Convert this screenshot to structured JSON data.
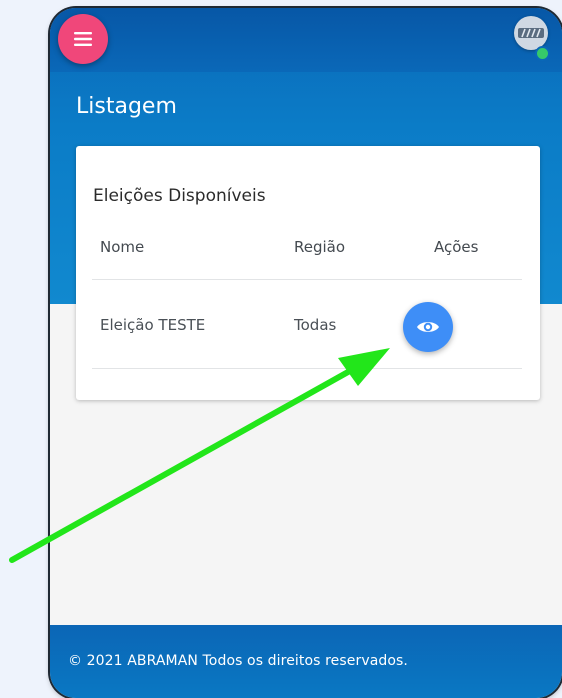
{
  "header": {
    "menu_icon": "hamburger-menu-icon",
    "avatar_icon": "user-avatar-icon"
  },
  "page": {
    "title": "Listagem"
  },
  "card": {
    "title": "Eleições Disponíveis",
    "columns": [
      "Nome",
      "Região",
      "Ações"
    ],
    "rows": [
      {
        "name": "Eleição TESTE",
        "region": "Todas",
        "action_icon": "eye-icon"
      }
    ]
  },
  "footer": {
    "text": "© 2021 ABRAMAN Todos os direitos reservados."
  },
  "colors": {
    "primary": "#0a68b8",
    "menu_button": "#f0477a",
    "view_button": "#3e8ef7",
    "status_online": "#36c96a",
    "annotation_arrow": "#22e61a"
  }
}
